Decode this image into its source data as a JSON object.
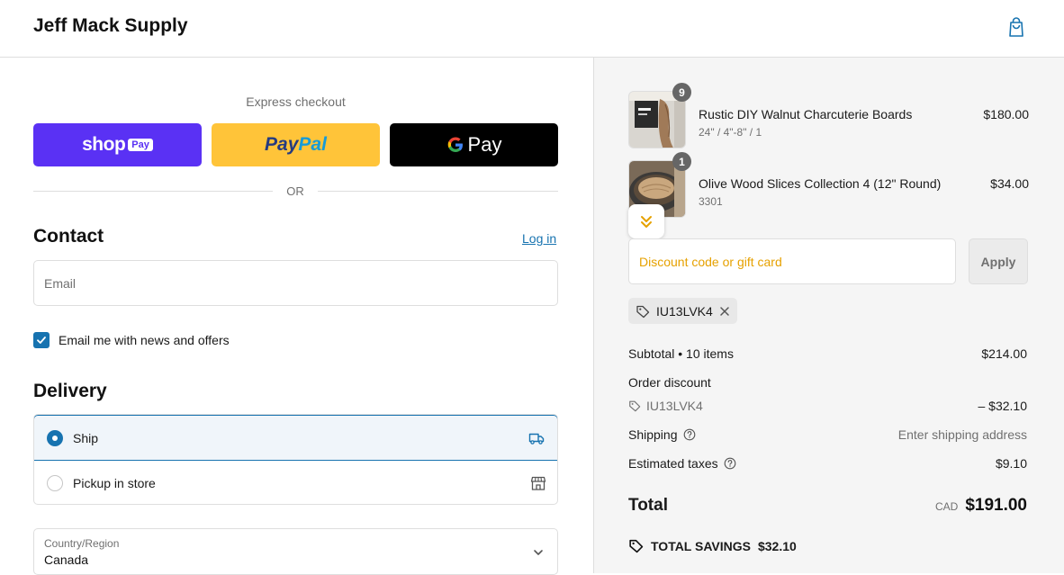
{
  "header": {
    "store_name": "Jeff Mack Supply",
    "cart_icon": "shopping-bag-icon"
  },
  "express": {
    "label": "Express checkout",
    "shop_pay": {
      "word": "shop",
      "chip": "Pay"
    },
    "paypal": {
      "part1": "Pay",
      "part2": "Pal"
    },
    "gpay": {
      "g": "G",
      "word": "Pay"
    },
    "or_text": "OR"
  },
  "contact": {
    "title": "Contact",
    "login_link": "Log in",
    "email_placeholder": "Email",
    "newsletter_label": "Email me with news and offers",
    "newsletter_checked": true
  },
  "delivery": {
    "title": "Delivery",
    "options": [
      {
        "label": "Ship",
        "selected": true,
        "icon": "truck-icon"
      },
      {
        "label": "Pickup in store",
        "selected": false,
        "icon": "store-icon"
      }
    ],
    "country_label": "Country/Region",
    "country_value": "Canada"
  },
  "summary": {
    "items": [
      {
        "name": "Rustic DIY Walnut Charcuterie Boards",
        "variant": "24\" / 4\"-8\" / 1",
        "price": "$180.00",
        "qty": "9"
      },
      {
        "name": "Olive Wood Slices Collection 4 (12\" Round)",
        "variant": "3301",
        "price": "$34.00",
        "qty": "1"
      }
    ],
    "discount_placeholder": "Discount code or gift card",
    "apply_label": "Apply",
    "applied_code": "IU13LVK4",
    "subtotal_label": "Subtotal • 10 items",
    "subtotal_value": "$214.00",
    "order_discount_label": "Order discount",
    "order_discount_code": "IU13LVK4",
    "order_discount_value": "– $32.10",
    "shipping_label": "Shipping",
    "shipping_value": "Enter shipping address",
    "taxes_label": "Estimated taxes",
    "taxes_value": "$9.10",
    "total_label": "Total",
    "total_currency": "CAD",
    "total_value": "$191.00",
    "savings_label": "TOTAL SAVINGS",
    "savings_value": "$32.10"
  },
  "colors": {
    "accent": "#1773b0",
    "shop_pay": "#5a31f4",
    "paypal": "#ffc439",
    "discount_placeholder": "#e6a100"
  }
}
